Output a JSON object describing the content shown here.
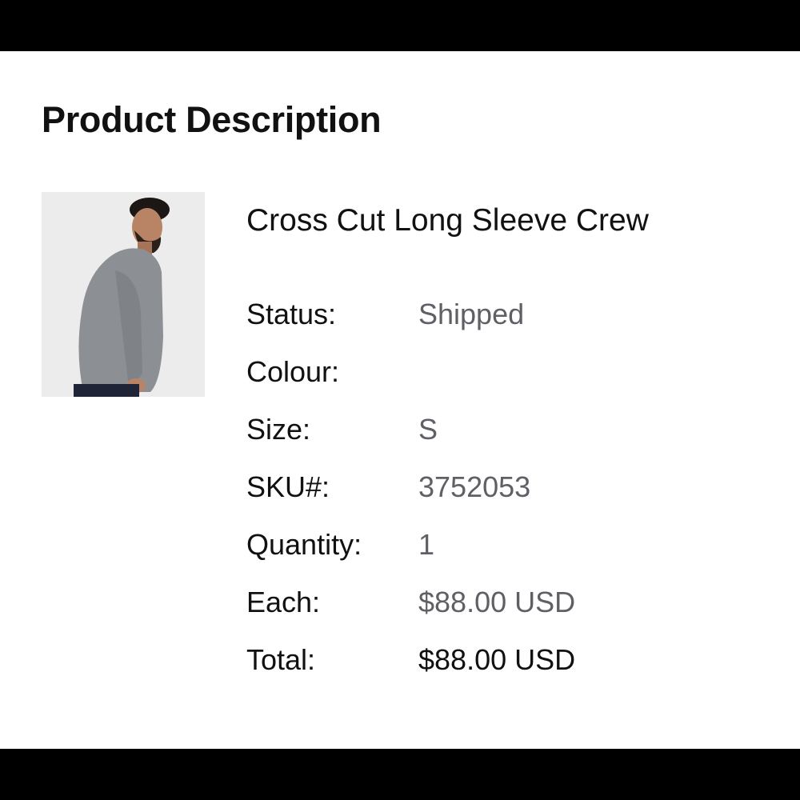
{
  "page": {
    "title": "Product Description"
  },
  "product": {
    "name": "Cross Cut Long Sleeve Crew",
    "image_alt": "man wearing grey long sleeve crew",
    "details": [
      {
        "label": "Status:",
        "value": "Shipped"
      },
      {
        "label": "Colour:",
        "value": ""
      },
      {
        "label": "Size:",
        "value": "S"
      },
      {
        "label": "SKU#:",
        "value": "3752053"
      },
      {
        "label": "Quantity:",
        "value": "1"
      },
      {
        "label": "Each:",
        "value": "$88.00 USD"
      },
      {
        "label": "Total:",
        "value": "$88.00 USD"
      }
    ]
  },
  "colors": {
    "label_text": "#111111",
    "value_text": "#5f5f66",
    "sweater": "#8c9095",
    "pants": "#1f2436"
  }
}
